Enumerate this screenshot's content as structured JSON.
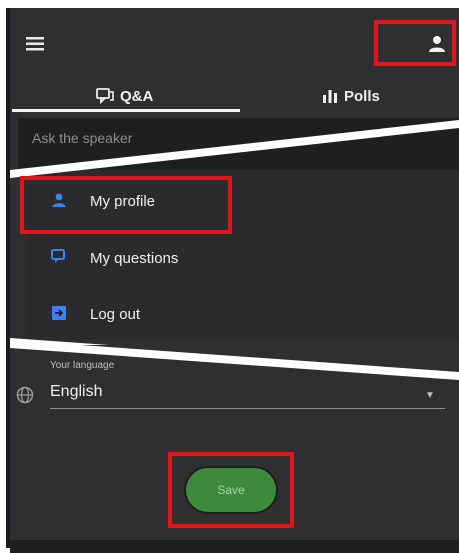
{
  "tabs": [
    {
      "label": "Q&A",
      "active": true
    },
    {
      "label": "Polls",
      "active": false
    }
  ],
  "ask_placeholder": "Ask the speaker",
  "menu_items": [
    {
      "label": "My profile",
      "icon": "person-icon"
    },
    {
      "label": "My questions",
      "icon": "chat-bubble-icon"
    },
    {
      "label": "Log out",
      "icon": "logout-icon"
    }
  ],
  "language": {
    "caption": "Your language",
    "value": "English"
  },
  "save_label": "Save",
  "colors": {
    "accent_blue": "#3b82f6",
    "save_green": "#3d8a3d",
    "highlight_red": "#e1131b",
    "background": "#2f2f31"
  }
}
